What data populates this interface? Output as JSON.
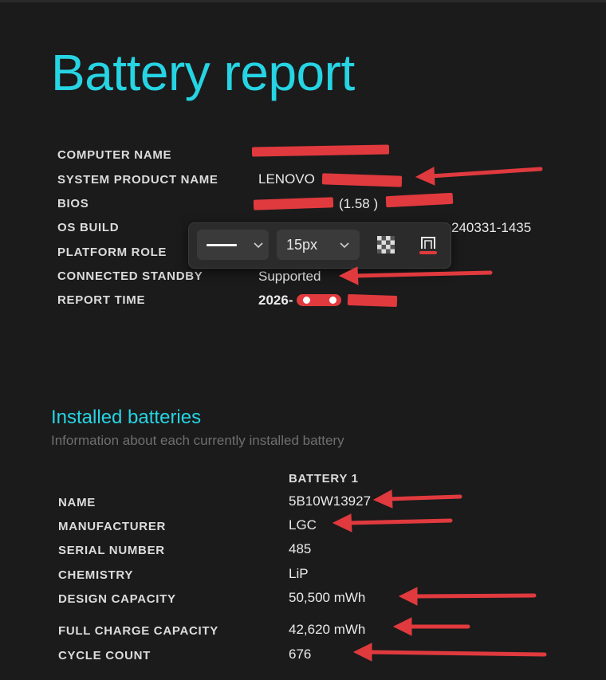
{
  "report": {
    "title": "Battery report",
    "system": [
      {
        "label": "COMPUTER NAME",
        "value": ""
      },
      {
        "label": "SYSTEM PRODUCT NAME",
        "value": "LENOVO"
      },
      {
        "label": "BIOS",
        "value": "(1.58 )"
      },
      {
        "label": "OS BUILD",
        "value": "240331-1435"
      },
      {
        "label": "PLATFORM ROLE",
        "value": ""
      },
      {
        "label": "CONNECTED STANDBY",
        "value": "Supported"
      },
      {
        "label": "REPORT TIME",
        "value": "2026-"
      }
    ]
  },
  "toolbar": {
    "stroke_style": "solid-line",
    "font_size": "15px",
    "icons": [
      "chevron-down-icon",
      "transparency-icon",
      "text-highlight-icon"
    ]
  },
  "batteries": {
    "title": "Installed batteries",
    "subtitle": "Information about each currently installed battery",
    "column_header": "BATTERY 1",
    "rows": [
      {
        "label": "NAME",
        "value": "5B10W13927"
      },
      {
        "label": "MANUFACTURER",
        "value": "LGC"
      },
      {
        "label": "SERIAL NUMBER",
        "value": "485"
      },
      {
        "label": "CHEMISTRY",
        "value": "LiP"
      },
      {
        "label": "DESIGN CAPACITY",
        "value": "50,500 mWh"
      },
      {
        "label": "FULL CHARGE CAPACITY",
        "value": "42,620 mWh"
      },
      {
        "label": "CYCLE COUNT",
        "value": "676"
      }
    ]
  },
  "colors": {
    "accent": "#26d4e3",
    "annotation": "#e03a3e",
    "background": "#1b1b1b"
  }
}
